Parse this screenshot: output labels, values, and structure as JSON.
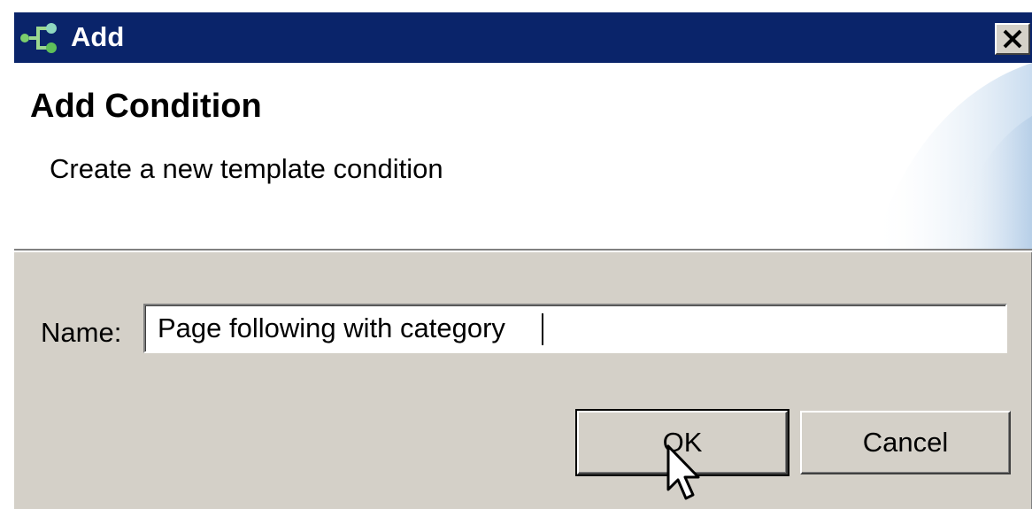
{
  "window": {
    "title": "Add",
    "app_icon": "workflow-icon",
    "close_icon": "close-icon"
  },
  "banner": {
    "title": "Add Condition",
    "description": "Create a new template condition"
  },
  "form": {
    "name_label": "Name:",
    "name_value": "Page following with category"
  },
  "buttons": {
    "ok_label": "OK",
    "cancel_label": "Cancel"
  },
  "colors": {
    "titlebar": "#0a246a",
    "dialog_face": "#d4d0c8",
    "banner_bg": "#ffffff",
    "swoosh": "#d8e6f4"
  }
}
